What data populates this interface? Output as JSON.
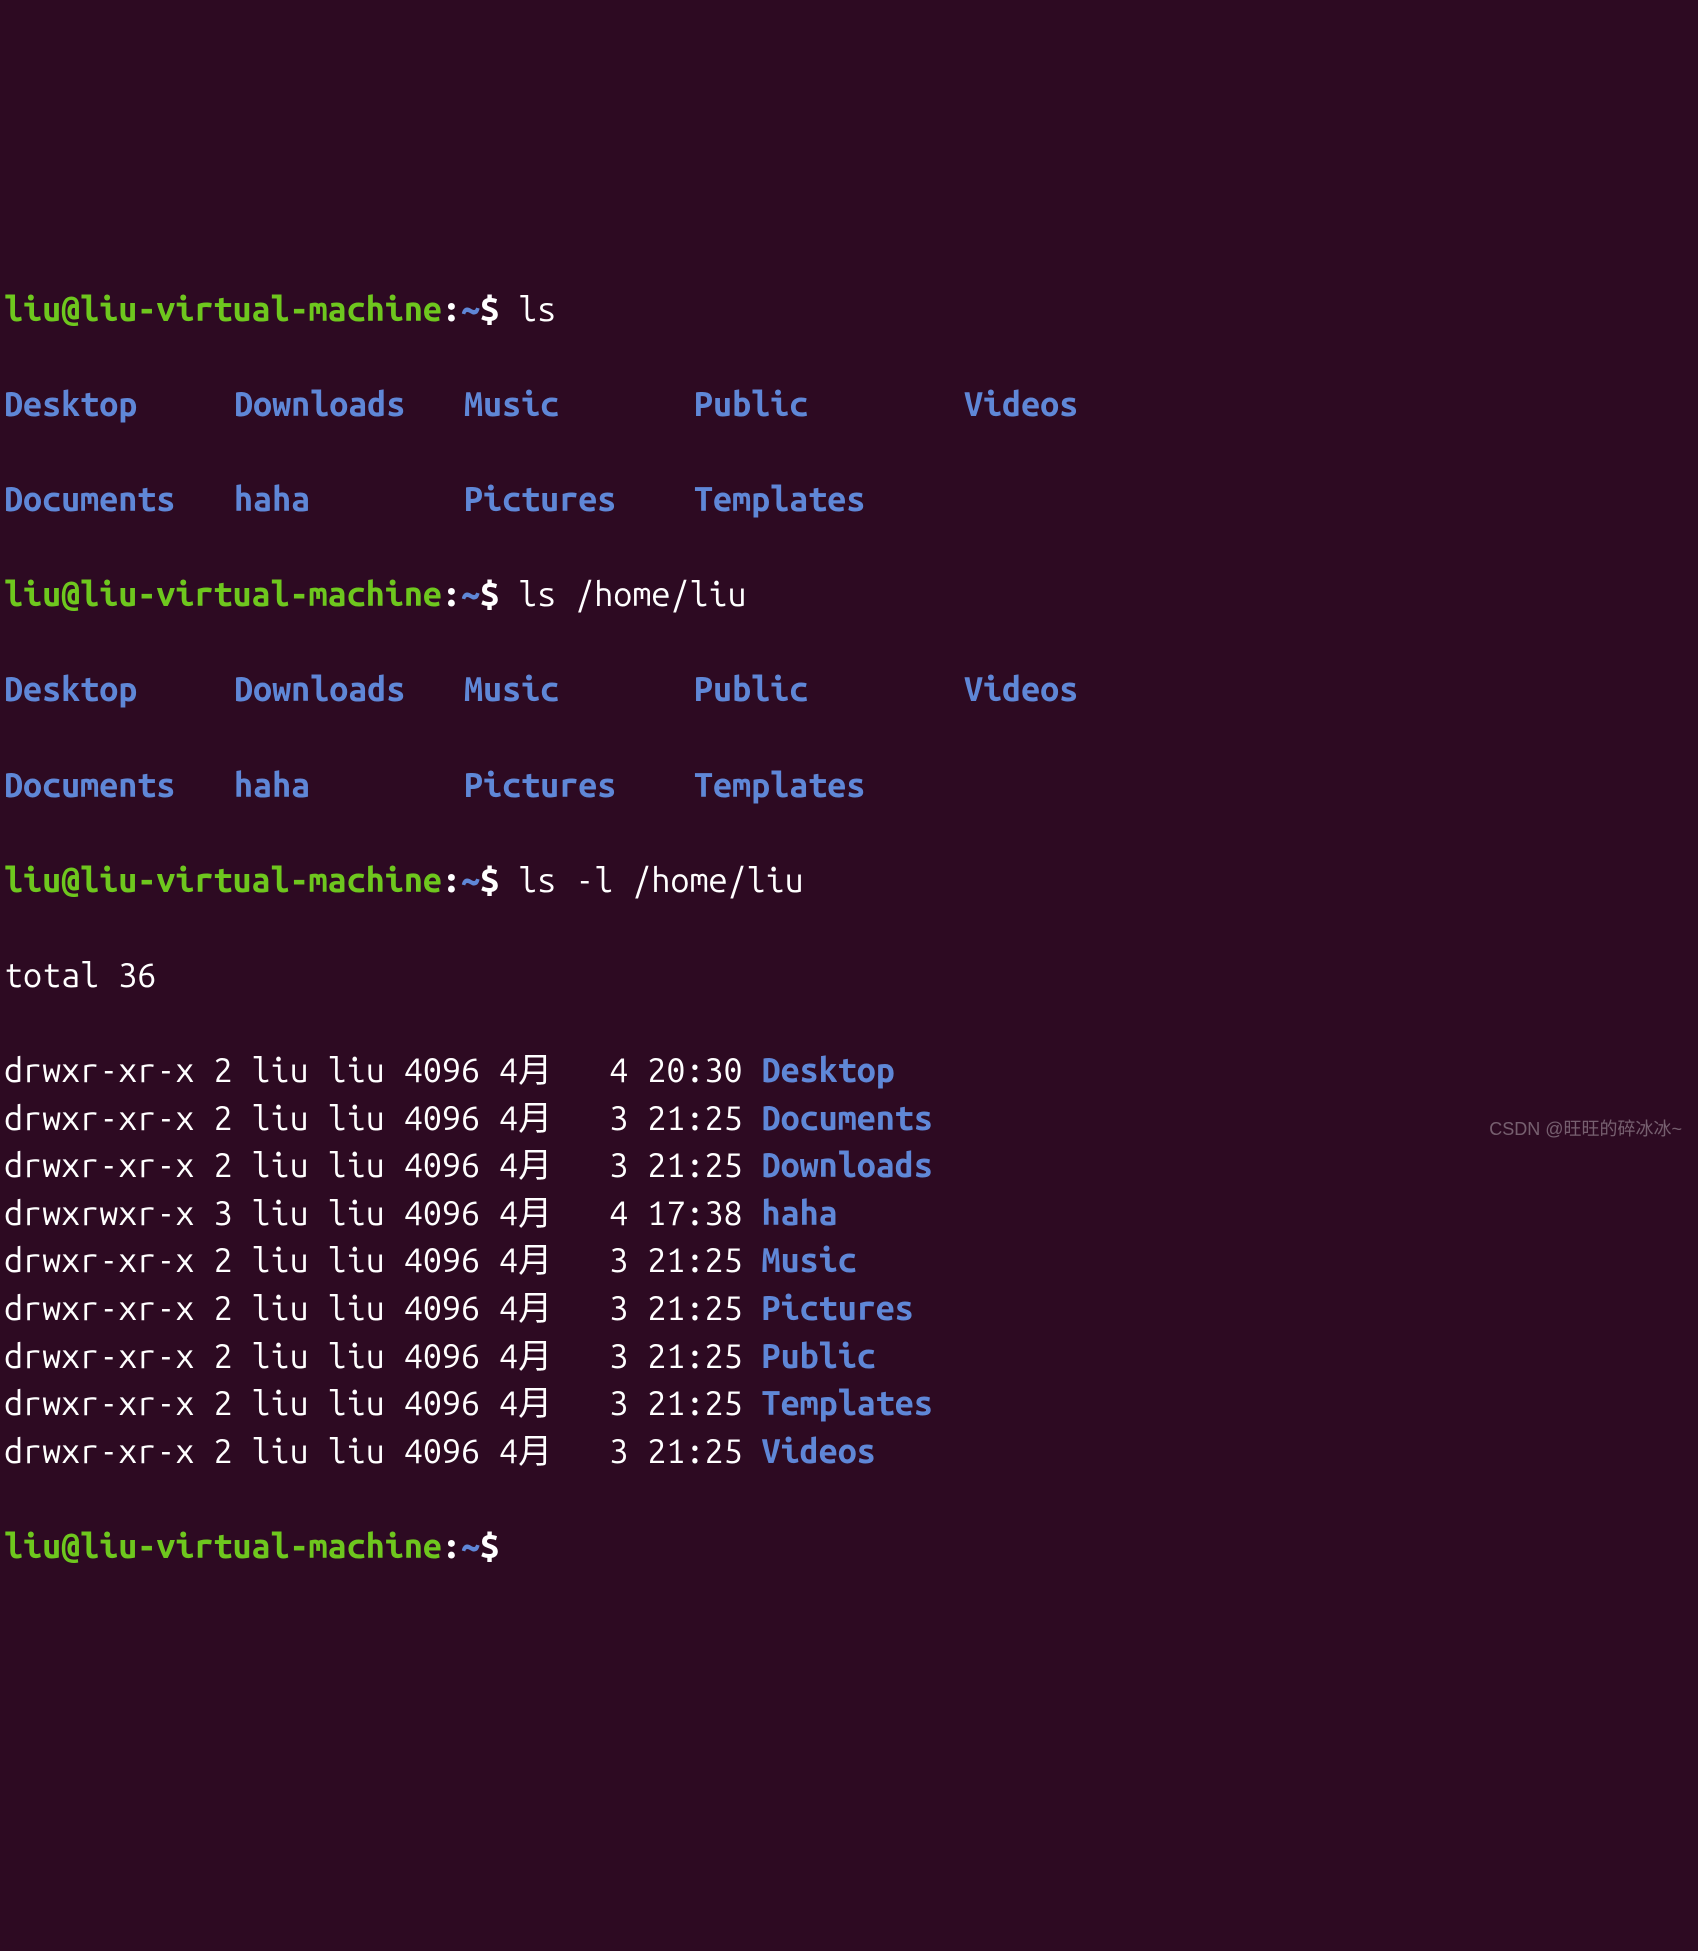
{
  "prompt": {
    "user": "liu@liu-virtual-machine",
    "colon": ":",
    "path": "~",
    "symbol": "$"
  },
  "commands": {
    "cmd1": "ls",
    "cmd2": "ls /home/liu",
    "cmd3": "ls -l /home/liu"
  },
  "ls_output": {
    "row1": [
      "Desktop",
      "Downloads",
      "Music",
      "Public",
      "Videos"
    ],
    "row2": [
      "Documents",
      "haha",
      "Pictures",
      "Templates"
    ]
  },
  "ls_l": {
    "total_line": "total 36",
    "entries": [
      {
        "perm": "drwxr-xr-x",
        "links": "2",
        "owner": "liu",
        "group": "liu",
        "size": "4096",
        "month": "4月",
        "day": "4",
        "time": "20:30",
        "name": "Desktop"
      },
      {
        "perm": "drwxr-xr-x",
        "links": "2",
        "owner": "liu",
        "group": "liu",
        "size": "4096",
        "month": "4月",
        "day": "3",
        "time": "21:25",
        "name": "Documents"
      },
      {
        "perm": "drwxr-xr-x",
        "links": "2",
        "owner": "liu",
        "group": "liu",
        "size": "4096",
        "month": "4月",
        "day": "3",
        "time": "21:25",
        "name": "Downloads"
      },
      {
        "perm": "drwxrwxr-x",
        "links": "3",
        "owner": "liu",
        "group": "liu",
        "size": "4096",
        "month": "4月",
        "day": "4",
        "time": "17:38",
        "name": "haha"
      },
      {
        "perm": "drwxr-xr-x",
        "links": "2",
        "owner": "liu",
        "group": "liu",
        "size": "4096",
        "month": "4月",
        "day": "3",
        "time": "21:25",
        "name": "Music"
      },
      {
        "perm": "drwxr-xr-x",
        "links": "2",
        "owner": "liu",
        "group": "liu",
        "size": "4096",
        "month": "4月",
        "day": "3",
        "time": "21:25",
        "name": "Pictures"
      },
      {
        "perm": "drwxr-xr-x",
        "links": "2",
        "owner": "liu",
        "group": "liu",
        "size": "4096",
        "month": "4月",
        "day": "3",
        "time": "21:25",
        "name": "Public"
      },
      {
        "perm": "drwxr-xr-x",
        "links": "2",
        "owner": "liu",
        "group": "liu",
        "size": "4096",
        "month": "4月",
        "day": "3",
        "time": "21:25",
        "name": "Templates"
      },
      {
        "perm": "drwxr-xr-x",
        "links": "2",
        "owner": "liu",
        "group": "liu",
        "size": "4096",
        "month": "4月",
        "day": "3",
        "time": "21:25",
        "name": "Videos"
      }
    ]
  },
  "watermark": "CSDN @旺旺的碎冰冰~"
}
